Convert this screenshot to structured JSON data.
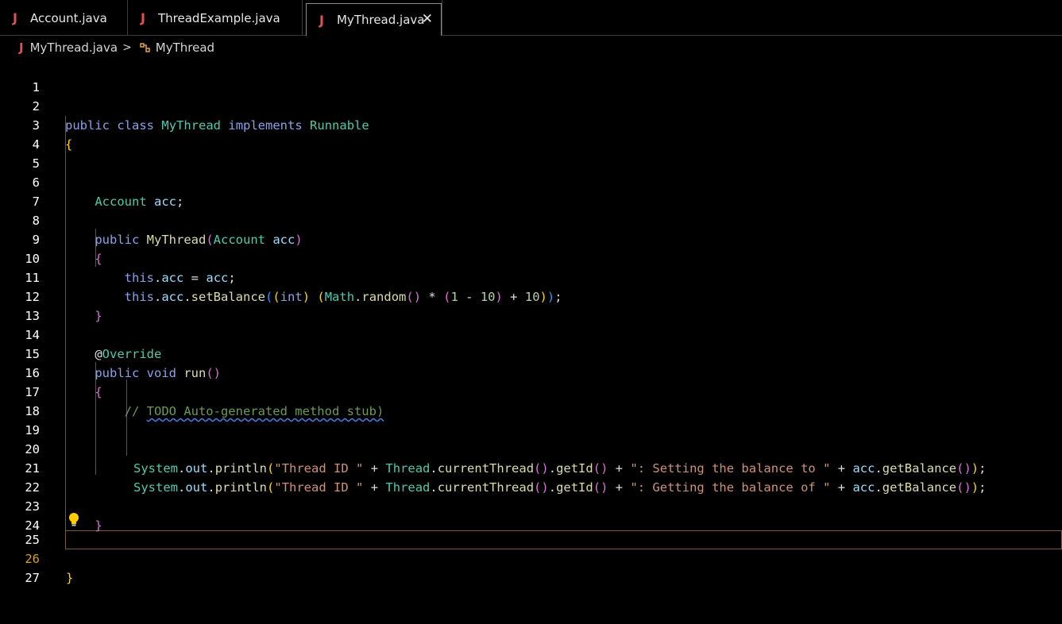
{
  "tabs": [
    {
      "icon": "J",
      "label": "Account.java",
      "active": false
    },
    {
      "icon": "J",
      "label": "ThreadExample.java",
      "active": false
    },
    {
      "icon": "J",
      "label": "MyThread.java",
      "active": true
    }
  ],
  "breadcrumb": {
    "file": "MyThread.java",
    "symbol": "MyThread"
  },
  "editor": {
    "current_line": 26,
    "line_numbers": [
      "1",
      "2",
      "3",
      "4",
      "5",
      "6",
      "7",
      "8",
      "9",
      "10",
      "11",
      "12",
      "13",
      "14",
      "15",
      "16",
      "17",
      "18",
      "19",
      "20",
      "21",
      "22",
      "23",
      "24",
      "25",
      "26",
      "27"
    ],
    "code": {
      "l2": {
        "public": "public",
        "class": "class",
        "name": "MyThread",
        "implements": "implements",
        "iface": "Runnable"
      },
      "l6": {
        "type": "Account",
        "var": "acc"
      },
      "l8": {
        "public": "public",
        "name": "MyThread",
        "ptype": "Account",
        "pvar": "acc"
      },
      "l10": {
        "this": "this",
        "field": "acc",
        "rhs": "acc"
      },
      "l11": {
        "this": "this",
        "field": "acc",
        "method": "setBalance",
        "cast": "int",
        "cls": "Math",
        "rand": "random",
        "n1": "1",
        "n2": "10",
        "n3": "10"
      },
      "l14": {
        "annotation": "Override"
      },
      "l15": {
        "public": "public",
        "void": "void",
        "name": "run"
      },
      "l17": {
        "comment": "// ",
        "todo": "TODO Auto-generated method stub)"
      },
      "l20": {
        "sys": "System",
        "out": "out",
        "println": "println",
        "s1": "\"Thread ID \"",
        "thread": "Thread",
        "ct": "currentThread",
        "gid": "getId",
        "s2": "\": Setting the balance to \"",
        "acc": "acc",
        "gb": "getBalance"
      },
      "l21": {
        "sys": "System",
        "out": "out",
        "println": "println",
        "s1": "\"Thread ID \"",
        "thread": "Thread",
        "ct": "currentThread",
        "gid": "getId",
        "s2": "\": Getting the balance of \"",
        "acc": "acc",
        "gb": "getBalance"
      }
    }
  },
  "colors": {
    "java_icon": "#e05252",
    "current_line_border": "#7a5a3a",
    "keyword": "#8aa0e8",
    "type": "#4ec9b0",
    "string": "#ce9178"
  }
}
